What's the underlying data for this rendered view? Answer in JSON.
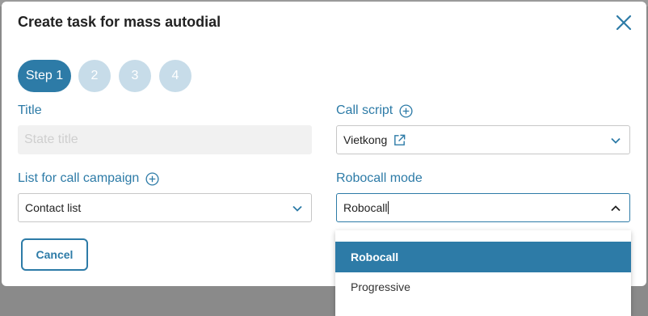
{
  "dialog": {
    "title": "Create task for mass autodial"
  },
  "steps": [
    {
      "label": "Step 1",
      "active": true
    },
    {
      "label": "2",
      "active": false
    },
    {
      "label": "3",
      "active": false
    },
    {
      "label": "4",
      "active": false
    }
  ],
  "form": {
    "title_label": "Title",
    "title_placeholder": "State title",
    "call_script_label": "Call script",
    "call_script_value": "Vietkong",
    "list_label": "List for call campaign",
    "list_value": "Contact list",
    "robocall_label": "Robocall mode",
    "robocall_value": "Robocall"
  },
  "dropdown": {
    "options": [
      "Robocall",
      "Progressive"
    ],
    "selected": "Robocall"
  },
  "buttons": {
    "cancel": "Cancel"
  },
  "colors": {
    "accent": "#2d7ba7",
    "step_inactive": "#c7dce9",
    "disabled_field": "#f1f1f1"
  }
}
